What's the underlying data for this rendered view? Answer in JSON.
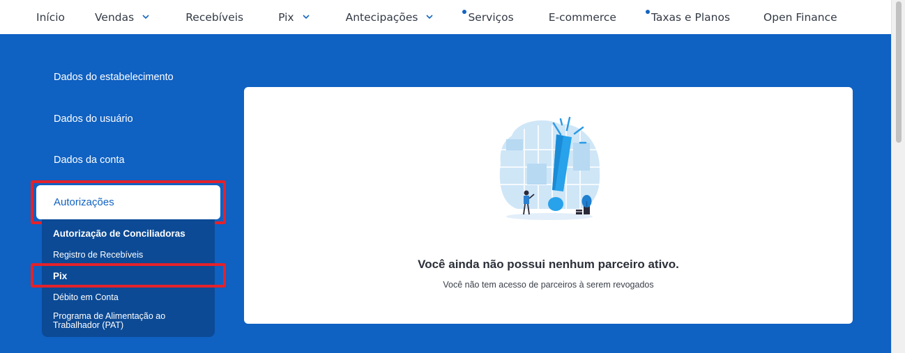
{
  "topnav": {
    "items": [
      {
        "label": "Início",
        "has_dropdown": false,
        "has_dot": false
      },
      {
        "label": "Vendas",
        "has_dropdown": true,
        "has_dot": false
      },
      {
        "label": "Recebíveis",
        "has_dropdown": false,
        "has_dot": false
      },
      {
        "label": "Pix",
        "has_dropdown": true,
        "has_dot": false
      },
      {
        "label": "Antecipações",
        "has_dropdown": true,
        "has_dot": false
      },
      {
        "label": "Serviços",
        "has_dropdown": false,
        "has_dot": true
      },
      {
        "label": "E-commerce",
        "has_dropdown": false,
        "has_dot": false
      },
      {
        "label": "Taxas e Planos",
        "has_dropdown": false,
        "has_dot": true
      },
      {
        "label": "Open Finance",
        "has_dropdown": false,
        "has_dot": false
      }
    ]
  },
  "sidebar": {
    "links": [
      {
        "label": "Dados do estabelecimento"
      },
      {
        "label": "Dados do usuário"
      },
      {
        "label": "Dados da conta"
      }
    ],
    "active": {
      "label": "Autorizações"
    },
    "submenu": [
      {
        "label": "Autorização de Conciliadoras",
        "bold": true
      },
      {
        "label": "Registro de Recebíveis",
        "bold": false
      },
      {
        "label": "Pix",
        "bold": true
      },
      {
        "label": "Débito em Conta",
        "bold": false
      },
      {
        "label": "Programa de Alimentação ao Trabalhador (PAT)",
        "bold": false
      }
    ]
  },
  "empty_state": {
    "illustration_icon": "exclamation-illustration",
    "title": "Você ainda não possui nenhum parceiro ativo.",
    "subtitle": "Você não tem acesso de parceiros à serem revogados"
  },
  "colors": {
    "brand_blue": "#0f61c2",
    "submenu_bg": "#0c4a95",
    "highlight_red": "#e3222b"
  }
}
